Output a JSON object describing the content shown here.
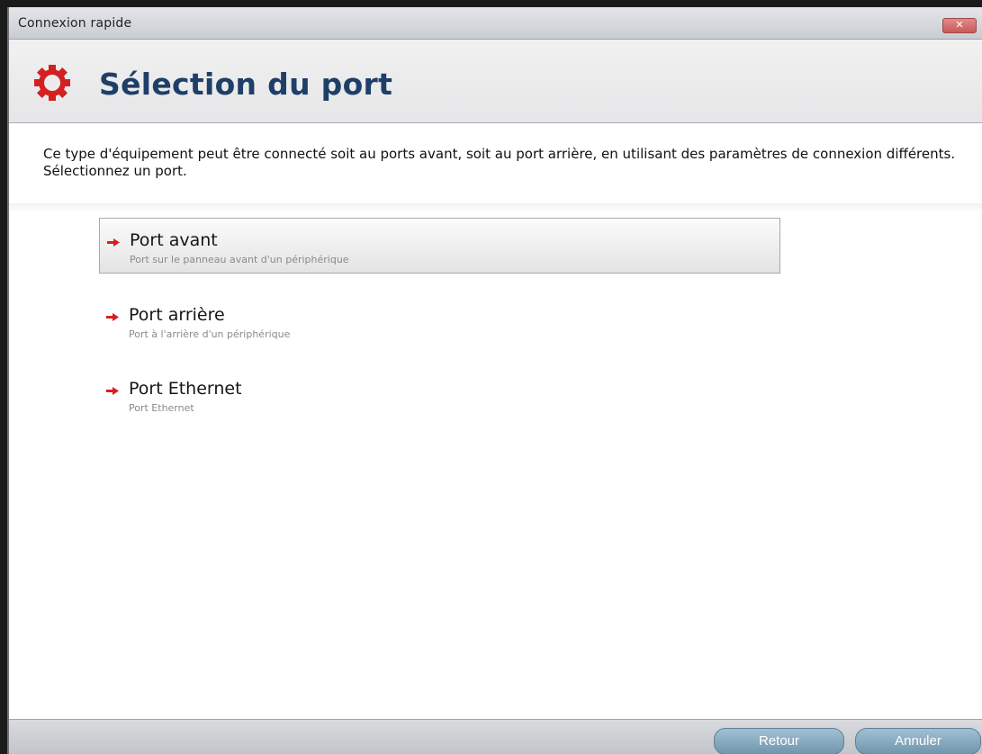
{
  "window": {
    "title": "Connexion rapide",
    "close_label": "✕"
  },
  "header": {
    "icon": "gear-icon",
    "title": "Sélection du port",
    "accent_color": "#d42020",
    "title_color": "#1e3f67"
  },
  "description": "Ce type d'équipement peut être connecté soit au ports avant, soit au port arrière, en utilisant des paramètres de connexion différents. Sélectionnez un port.",
  "ports": [
    {
      "label": "Port avant",
      "description": "Port sur le panneau avant d'un périphérique",
      "selected": true,
      "icon": "arrow-right-icon"
    },
    {
      "label": "Port arrière",
      "description": "Port à l'arrière d'un périphérique",
      "selected": false,
      "icon": "arrow-right-icon"
    },
    {
      "label": "Port Ethernet",
      "description": "Port Ethernet",
      "selected": false,
      "icon": "arrow-right-icon"
    }
  ],
  "footer": {
    "back_label": "Retour",
    "cancel_label": "Annuler"
  }
}
